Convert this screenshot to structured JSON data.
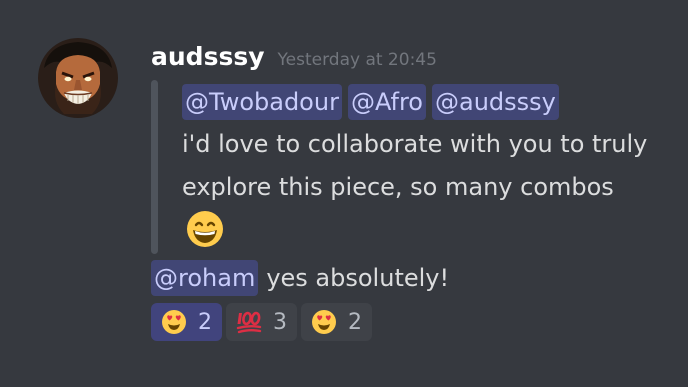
{
  "message": {
    "author": "audsssy",
    "timestamp": "Yesterday at 20:45",
    "avatar_icon": "avatar-image",
    "quote": {
      "mentions": [
        "@Twobadour",
        "@Afro",
        "@audsssy"
      ],
      "text": "i'd love to collaborate with you to truly explore this piece, so many combos",
      "emoji": "grinning-face-with-smiling-eyes"
    },
    "reply": {
      "mention": "@roham",
      "text": "yes absolutely!"
    },
    "reactions": [
      {
        "emoji": "smiling-face-with-heart-eyes",
        "count": "2"
      },
      {
        "emoji": "hundred-points",
        "count": "3"
      },
      {
        "emoji": "smiling-face-with-heart-eyes",
        "count": "2"
      }
    ]
  },
  "colors": {
    "background": "#36393f",
    "mention_bg": "#414675",
    "mention_text": "#c9cdfb",
    "username": "#ffffff",
    "timestamp": "#72767d"
  }
}
